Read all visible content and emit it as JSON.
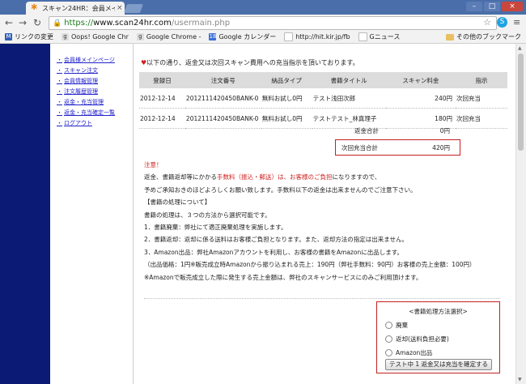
{
  "browser": {
    "tab_title": "スキャン24HR：会員メイ",
    "url_scheme": "https://",
    "url_host": "www.scan24hr.com",
    "url_path": "/usermain.php",
    "bookmarks": [
      {
        "label": "リンクの変更",
        "icon": "m-icon",
        "color": "#2f5fb3"
      },
      {
        "label": "Oops! Google Chr",
        "icon": "google-icon",
        "color": "#e0e0e0"
      },
      {
        "label": "Google Chrome - ",
        "icon": "google-icon",
        "color": "#e0e0e0"
      },
      {
        "label": "Google カレンダー",
        "icon": "calendar-icon",
        "color": "#3a6fd9"
      },
      {
        "label": "http://hit.kir.jp/fb",
        "icon": "page-icon",
        "color": "#d0d0d0"
      },
      {
        "label": "Gニュース",
        "icon": "page-icon",
        "color": "#d0d0d0"
      }
    ],
    "other_bookmarks": "その他のブックマーク"
  },
  "sidebar": {
    "items": [
      "会員様メインページ",
      "スキャン注文",
      "会員情報管理",
      "注文履歴管理",
      "返金・充当管理",
      "返金・充当確定一覧",
      "ログアウト"
    ]
  },
  "main": {
    "intro": "以下の通り、返金又は次回スキャン費用への充当指示を頂いております。",
    "table": {
      "headers": [
        "登録日",
        "注文番号",
        "納品タイプ",
        "書籍タイトル",
        "スキャン料金",
        "指示"
      ],
      "rows": [
        [
          "2012-12-14",
          "2012111420450BANK-0",
          "無料お試し0円",
          "テスト浅田次郎",
          "240円",
          "次回充当"
        ],
        [
          "2012-12-14",
          "2012111420450BANK-0",
          "無料お試し0円",
          "テストテスト_林真理子",
          "180円",
          "次回充当"
        ]
      ]
    },
    "refund_total_label": "返金合計",
    "refund_total_value": "0円",
    "carry_total_label": "次回充当合計",
    "carry_total_value": "420円",
    "notes": {
      "caution": "注意！",
      "line1_a": "返金、書籍返却等にかかる",
      "line1_red": "手数料（振込・郵送）は、お客様のご負担",
      "line1_b": "になりますので、",
      "line2": "予めご承知おきのほどよろしくお願い致します。手数料以下の返金は出来ませんのでご注意下さい。",
      "line3": "【書籍の処理について】",
      "line4": "書籍の処理は、３つの方法から選択可能です。",
      "line5": "1．書籍廃棄：弊社にて適正廃棄処理を実施します。",
      "line6": "2．書籍返却：返却に係る送料はお客様ご負担となります。また、返却方法の指定は出来ません。",
      "line7": "3．Amazon出品：弊社Amazonアカウントを利用し、お客様の書籍をAmazonに出品します。",
      "line8": "（出品価格：1円※販売成立時Amazonから振り込まれる売上：190円（弊社手数料：90円）お客様の売上金額：100円）",
      "line9": "※Amazonで販売成立した際に発生する売上金額は、弊社のスキャンサービスにのみご利用頂けます。"
    }
  },
  "process_box": {
    "heading": "<書籍処理方法選択>",
    "options": [
      "廃棄",
      "返却(送料負担必要)",
      "Amazon出品"
    ],
    "button": "テスト中 1 返金又は充当を確定する"
  }
}
